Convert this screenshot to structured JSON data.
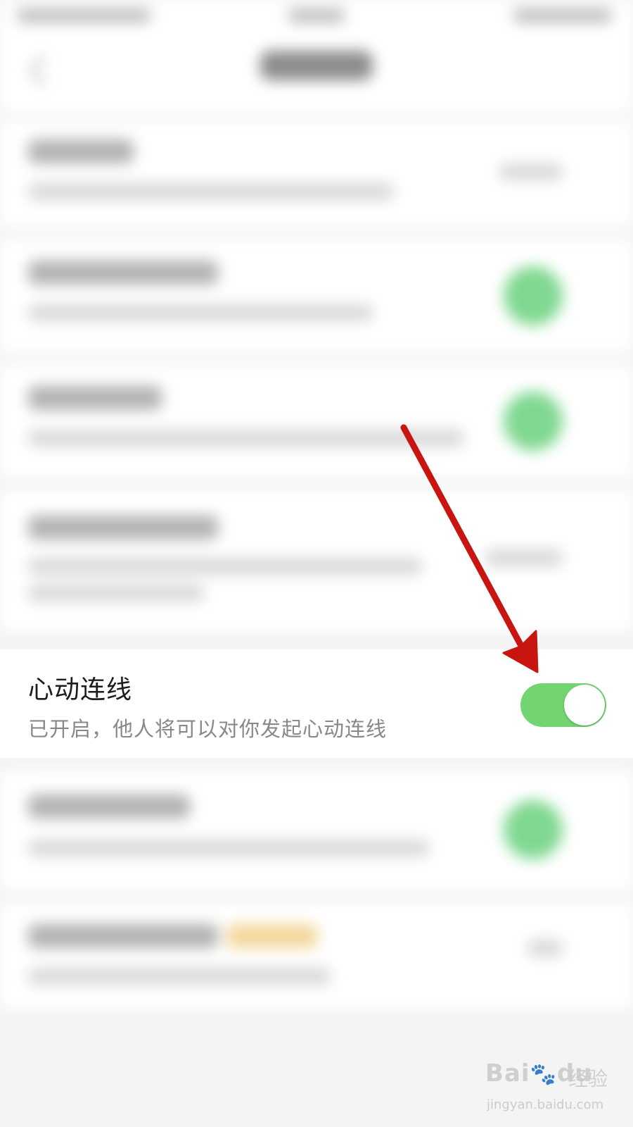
{
  "heartbeat_row": {
    "title": "心动连线",
    "subtitle": "已开启，他人将可以对你发起心动连线",
    "toggle_on": true,
    "toggle_color": "#72d572"
  },
  "annotation": {
    "arrow_color": "#c8150f"
  },
  "watermark": {
    "brand": "Bai",
    "brand_suffix": "du",
    "product": "经验",
    "url": "jingyan.baidu.com"
  }
}
